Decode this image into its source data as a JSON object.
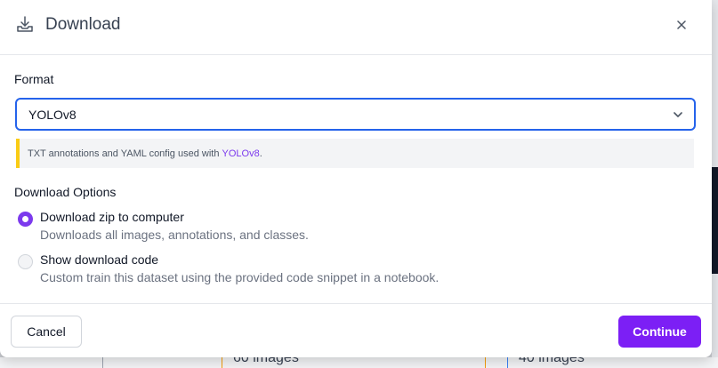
{
  "modal": {
    "title": "Download",
    "title_icon": "download-tray-icon",
    "close_icon": "close-icon"
  },
  "format": {
    "label": "Format",
    "selected": "YOLOv8",
    "chevron_icon": "chevron-down-icon",
    "info_prefix": "TXT annotations and YAML config used with ",
    "info_link": "YOLOv8",
    "info_suffix": "."
  },
  "download_options": {
    "label": "Download Options",
    "options": [
      {
        "title": "Download zip to computer",
        "description": "Downloads all images, annotations, and classes.",
        "selected": true
      },
      {
        "title": "Show download code",
        "description": "Custom train this dataset using the provided code snippet in a notebook.",
        "selected": false
      }
    ]
  },
  "footer": {
    "cancel_label": "Cancel",
    "continue_label": "Continue"
  },
  "background": {
    "fragment_1": "60 images",
    "fragment_2": "40 images"
  },
  "colors": {
    "accent": "#7c1ff5",
    "focus_border": "#2563eb",
    "info_bar": "#facc15",
    "link": "#7c3aed"
  }
}
